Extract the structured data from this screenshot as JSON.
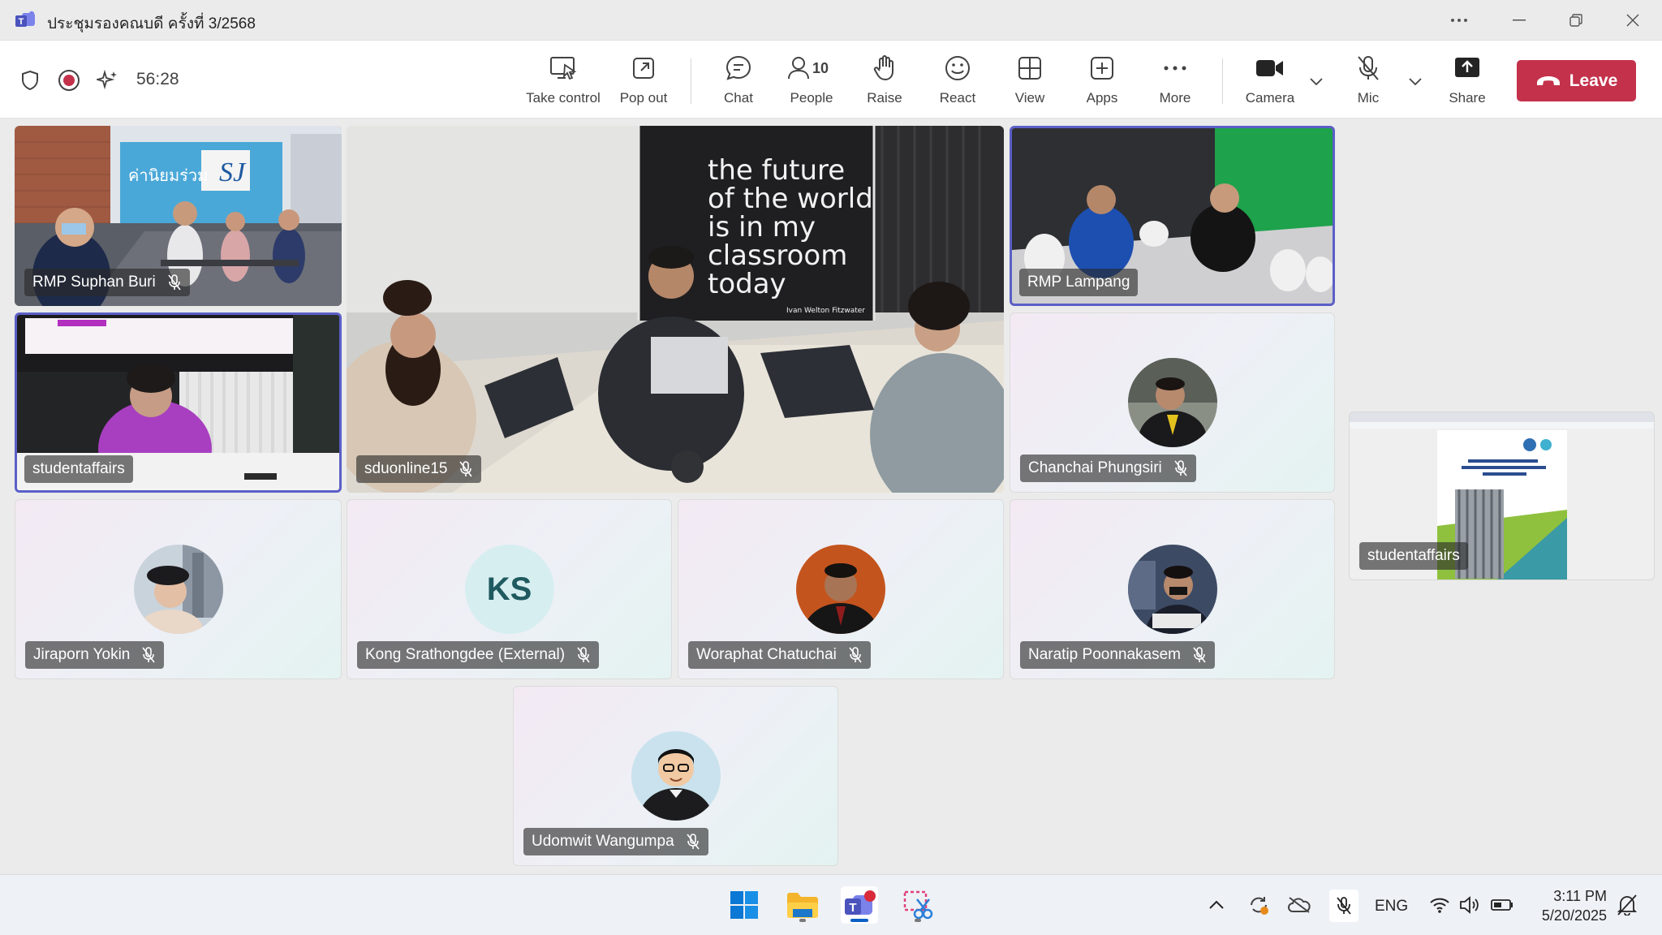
{
  "window": {
    "title": "ประชุมรองคณบดี ครั้งที่ 3/2568"
  },
  "toolbar": {
    "timer": "56:28",
    "take_control": "Take control",
    "pop_out": "Pop out",
    "chat": "Chat",
    "people": "People",
    "people_count": "10",
    "raise": "Raise",
    "react": "React",
    "view": "View",
    "apps": "Apps",
    "more": "More",
    "camera": "Camera",
    "mic": "Mic",
    "share": "Share",
    "leave": "Leave"
  },
  "participants": {
    "suphan_buri": "RMP Suphan Buri",
    "sduonline": "sduonline15",
    "lampang": "RMP Lampang",
    "studentaffairs": "studentaffairs",
    "chanchai": "Chanchai Phungsiri",
    "jiraporn": "Jiraporn Yokin",
    "kong": "Kong Srathongdee (External)",
    "kong_initials": "KS",
    "woraphat": "Woraphat Chatuchai",
    "naratip": "Naratip Poonnakasem",
    "udomwit": "Udomwit Wangumpa",
    "share_presenter": "studentaffairs"
  },
  "classroom_quote": {
    "line1": "the future",
    "line2": "of the world",
    "line3": "is in my",
    "line4": "classroom",
    "line5": "today",
    "author": "Ivan Welton Fitzwater"
  },
  "wall_sign": "ค่านิยมร่วม",
  "taskbar": {
    "language": "ENG",
    "time": "3:11 PM",
    "date": "5/20/2025"
  },
  "colors": {
    "leave": "#c4314b",
    "active_speaker": "#5b5fc7",
    "teams_brand": "#5b5fc7"
  }
}
